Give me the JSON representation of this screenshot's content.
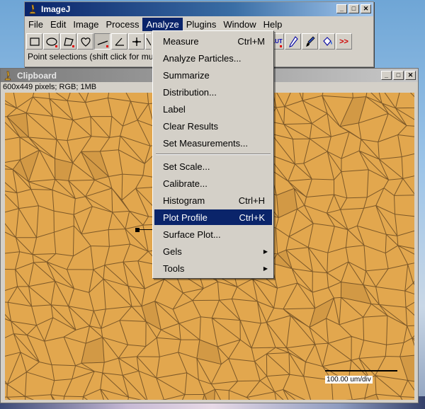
{
  "main_window": {
    "title": "ImageJ",
    "menus": [
      "File",
      "Edit",
      "Image",
      "Process",
      "Analyze",
      "Plugins",
      "Window",
      "Help"
    ],
    "active_menu": "Analyze",
    "status": "Point selections (shift click for mu",
    "toolbar": {
      "lut_label": "LUT",
      "more_label": ">>"
    },
    "title_buttons": {
      "minimize": "_",
      "maximize": "□",
      "close": "✕"
    }
  },
  "clipboard_window": {
    "title": "Clipboard",
    "info": "600x449 pixels; RGB; 1MB",
    "scale_label": "100.00 um/div"
  },
  "analyze_menu": {
    "group1": [
      {
        "label": "Measure",
        "shortcut": "Ctrl+M"
      },
      {
        "label": "Analyze Particles..."
      },
      {
        "label": "Summarize"
      },
      {
        "label": "Distribution..."
      },
      {
        "label": "Label"
      },
      {
        "label": "Clear Results"
      },
      {
        "label": "Set Measurements..."
      }
    ],
    "group2": [
      {
        "label": "Set Scale..."
      },
      {
        "label": "Calibrate..."
      },
      {
        "label": "Histogram",
        "shortcut": "Ctrl+H"
      },
      {
        "label": "Plot Profile",
        "shortcut": "Ctrl+K",
        "highlighted": true
      },
      {
        "label": "Surface Plot..."
      },
      {
        "label": "Gels",
        "submenu": true
      },
      {
        "label": "Tools",
        "submenu": true
      }
    ]
  },
  "colors": {
    "title_active": "#0a246a",
    "menu_highlight": "#0a246a",
    "image_background": "#e2a74e",
    "grain_boundary": "#6a4a22"
  }
}
